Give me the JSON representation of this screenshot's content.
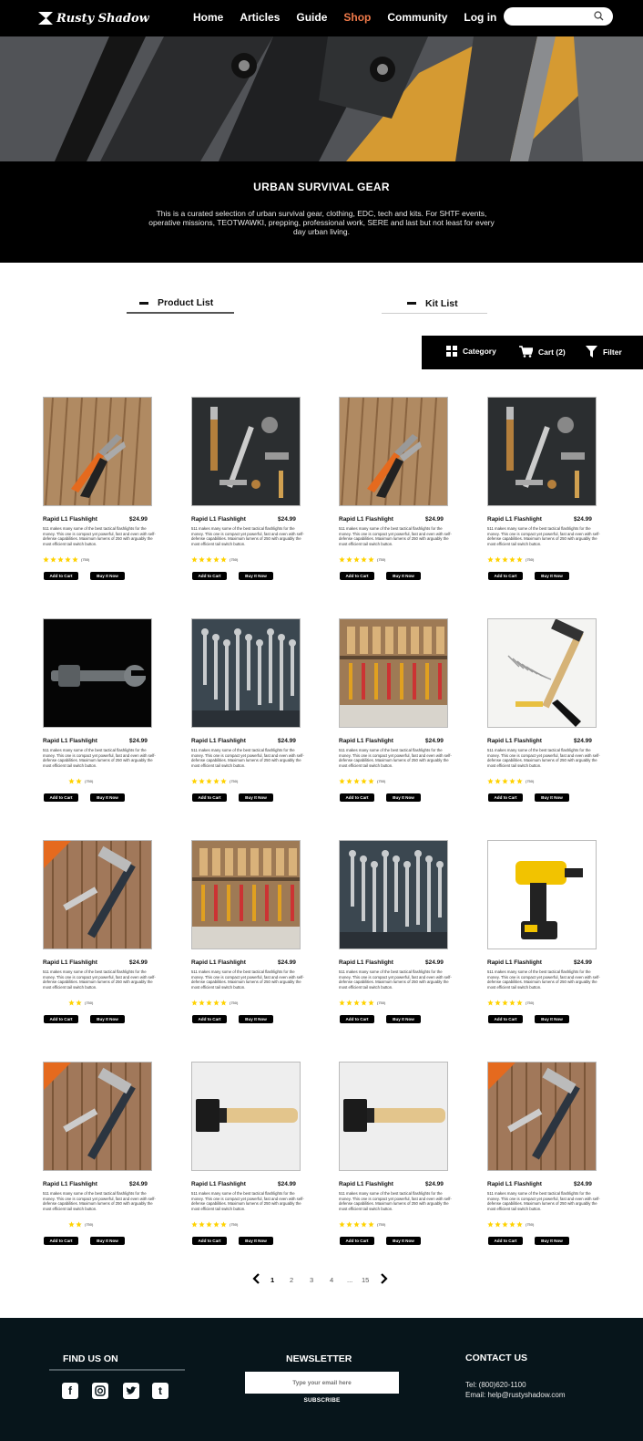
{
  "brand": {
    "name": "Rusty Shadow",
    "accent": "#f07a4a"
  },
  "nav": {
    "items": [
      "Home",
      "Articles",
      "Guide",
      "Shop",
      "Community",
      "Log in"
    ],
    "active": "Shop"
  },
  "search": {
    "value": "",
    "placeholder": ""
  },
  "hero": {
    "title": "URBAN SURVIVAL GEAR",
    "description": "This is a curated selection of urban survival gear, clothing, EDC, tech and kits. For SHTF events, operative missions, TEOTWAWKI, prepping, professional work, SERE and last but not least for every day urban living."
  },
  "tabs": {
    "product": "Product List",
    "kit": "Kit List"
  },
  "toolbar": {
    "category": "Category",
    "cart": "Cart (2)",
    "filter": "Filter"
  },
  "product_template": {
    "name": "Rapid L1 Flashlight",
    "price": "$24.99",
    "description": "511 makes many some of the best tactical flashlights for the money. This one is compact yet powerful, fast and even with self-defense capabilities. Maximum lumens of 250 with arguably the most efficient tail switch button.",
    "rating_count": "(750)",
    "add_label": "Add to Cart",
    "buy_label": "Buy It Now"
  },
  "products": [
    {
      "name": "Rapid L1 Flashlight",
      "price": "$24.99",
      "stars": 5,
      "rating_count": "(750)",
      "image": "pliers-icon"
    },
    {
      "name": "Rapid L1 Flashlight",
      "price": "$24.99",
      "stars": 5,
      "rating_count": "(750)",
      "image": "tools-flatlay-icon"
    },
    {
      "name": "Rapid L1 Flashlight",
      "price": "$24.99",
      "stars": 5,
      "rating_count": "(750)",
      "image": "pliers-icon"
    },
    {
      "name": "Rapid L1 Flashlight",
      "price": "$24.99",
      "stars": 5,
      "rating_count": "(750)",
      "image": "tools-flatlay-icon"
    },
    {
      "name": "Rapid L1 Flashlight",
      "price": "$24.99",
      "stars": 2,
      "rating_count": "(750)",
      "image": "wrench-icon"
    },
    {
      "name": "Rapid L1 Flashlight",
      "price": "$24.99",
      "stars": 5,
      "rating_count": "(750)",
      "image": "wrench-rack-icon"
    },
    {
      "name": "Rapid L1 Flashlight",
      "price": "$24.99",
      "stars": 5,
      "rating_count": "(750)",
      "image": "tool-wall-icon"
    },
    {
      "name": "Rapid L1 Flashlight",
      "price": "$24.99",
      "stars": 5,
      "rating_count": "(750)",
      "image": "hammer-nails-icon"
    },
    {
      "name": "Rapid L1 Flashlight",
      "price": "$24.99",
      "stars": 2,
      "rating_count": "(750)",
      "image": "hammer-wrench-icon"
    },
    {
      "name": "Rapid L1 Flashlight",
      "price": "$24.99",
      "stars": 5,
      "rating_count": "(750)",
      "image": "tool-wall-icon"
    },
    {
      "name": "Rapid L1 Flashlight",
      "price": "$24.99",
      "stars": 5,
      "rating_count": "(750)",
      "image": "wrench-rack-icon"
    },
    {
      "name": "Rapid L1 Flashlight",
      "price": "$24.99",
      "stars": 5,
      "rating_count": "(750)",
      "image": "drill-icon"
    },
    {
      "name": "Rapid L1 Flashlight",
      "price": "$24.99",
      "stars": 2,
      "rating_count": "(750)",
      "image": "hammer-wrench-icon"
    },
    {
      "name": "Rapid L1 Flashlight",
      "price": "$24.99",
      "stars": 5,
      "rating_count": "(750)",
      "image": "hammer-icon"
    },
    {
      "name": "Rapid L1 Flashlight",
      "price": "$24.99",
      "stars": 5,
      "rating_count": "(750)",
      "image": "hammer-icon"
    },
    {
      "name": "Rapid L1 Flashlight",
      "price": "$24.99",
      "stars": 5,
      "rating_count": "(750)",
      "image": "hammer-wrench-icon"
    }
  ],
  "pagination": {
    "pages": [
      "1",
      "2",
      "3",
      "4",
      "...",
      "15"
    ],
    "current": "1"
  },
  "footer": {
    "find_us": "FIND US ON",
    "social": [
      "facebook-icon",
      "instagram-icon",
      "twitter-icon",
      "tumblr-icon"
    ],
    "newsletter": "NEWSLETTER",
    "email_placeholder": "Type your email here",
    "subscribe": "SUBSCRIBE",
    "contact_title": "CONTACT US",
    "tel": "Tel: (800)620-1100",
    "email": "Email: help@rustyshadow.com"
  }
}
